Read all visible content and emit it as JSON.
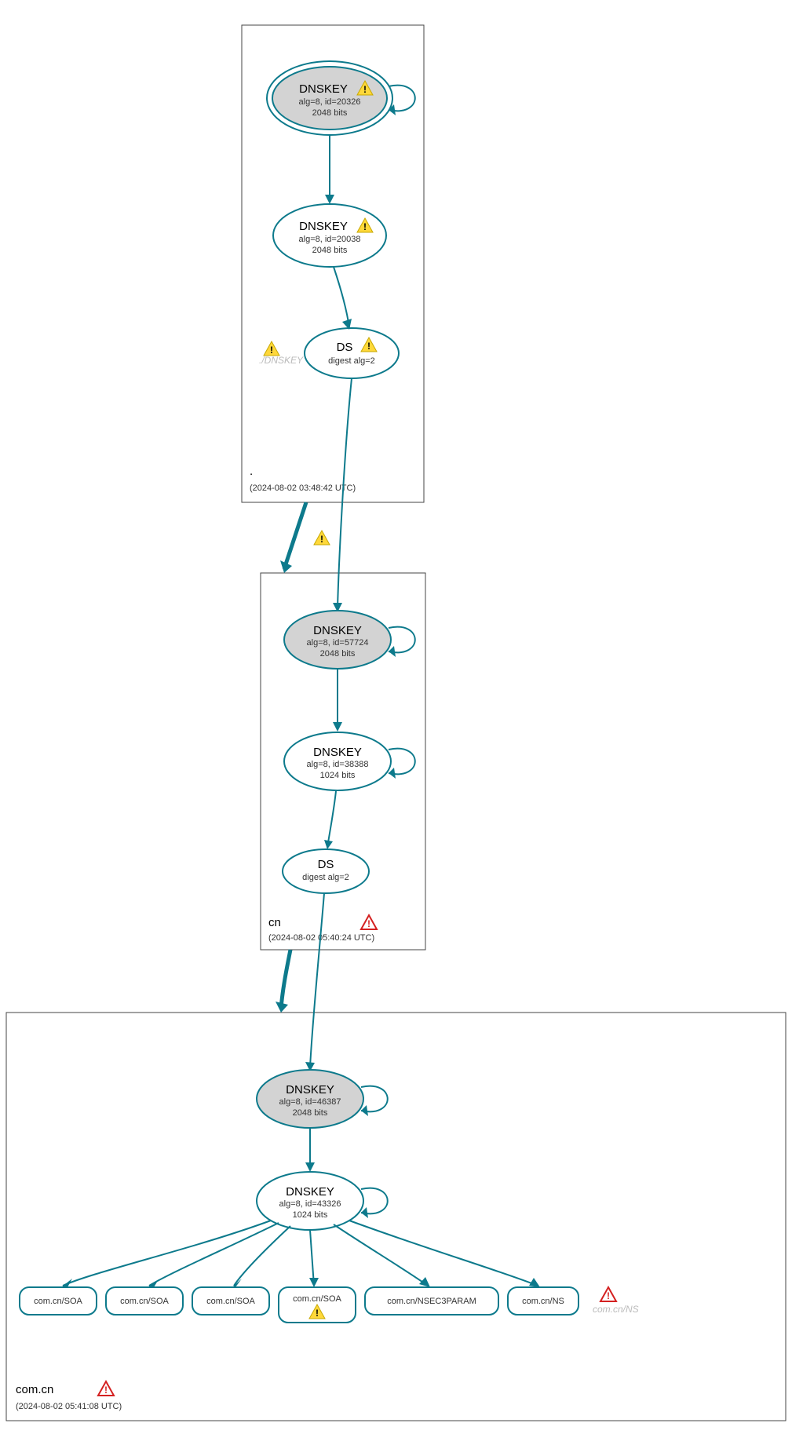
{
  "zones": {
    "root": {
      "label": ".",
      "timestamp": "(2024-08-02 03:48:42 UTC)"
    },
    "cn": {
      "label": "cn",
      "timestamp": "(2024-08-02 05:40:24 UTC)"
    },
    "comcn": {
      "label": "com.cn",
      "timestamp": "(2024-08-02 05:41:08 UTC)"
    }
  },
  "nodes": {
    "root_ksk": {
      "title": "DNSKEY",
      "sub1": "alg=8, id=20326",
      "sub2": "2048 bits"
    },
    "root_zsk": {
      "title": "DNSKEY",
      "sub1": "alg=8, id=20038",
      "sub2": "2048 bits"
    },
    "root_ds": {
      "title": "DS",
      "sub1": "digest alg=2"
    },
    "root_ghost": {
      "label": "./DNSKEY"
    },
    "cn_ksk": {
      "title": "DNSKEY",
      "sub1": "alg=8, id=57724",
      "sub2": "2048 bits"
    },
    "cn_zsk": {
      "title": "DNSKEY",
      "sub1": "alg=8, id=38388",
      "sub2": "1024 bits"
    },
    "cn_ds": {
      "title": "DS",
      "sub1": "digest alg=2"
    },
    "comcn_ksk": {
      "title": "DNSKEY",
      "sub1": "alg=8, id=46387",
      "sub2": "2048 bits"
    },
    "comcn_zsk": {
      "title": "DNSKEY",
      "sub1": "alg=8, id=43326",
      "sub2": "1024 bits"
    },
    "leaf1": {
      "label": "com.cn/SOA"
    },
    "leaf2": {
      "label": "com.cn/SOA"
    },
    "leaf3": {
      "label": "com.cn/SOA"
    },
    "leaf4": {
      "label": "com.cn/SOA"
    },
    "leaf5": {
      "label": "com.cn/NSEC3PARAM"
    },
    "leaf6": {
      "label": "com.cn/NS"
    },
    "ghost_ns": {
      "label": "com.cn/NS"
    }
  }
}
